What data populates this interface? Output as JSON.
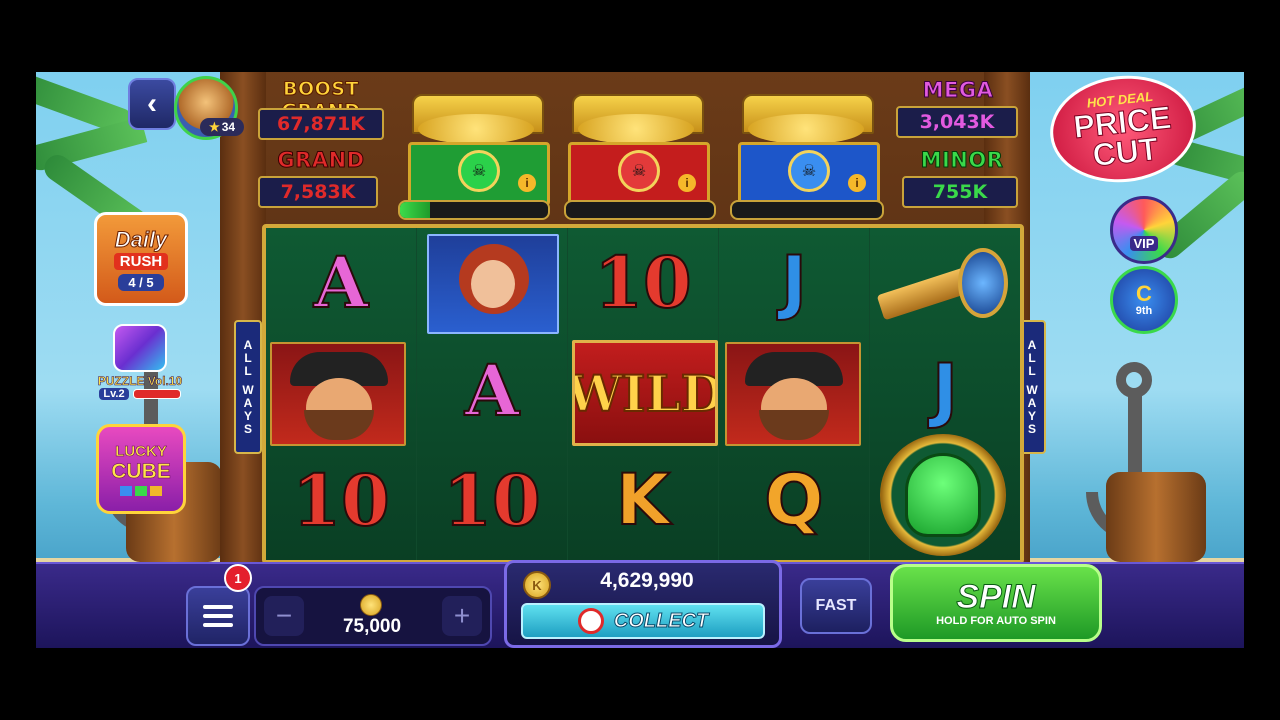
{
  "player": {
    "level": "34"
  },
  "jackpots": {
    "boost_grand": {
      "label": "BOOST GRAND",
      "value": "67,871K",
      "label_color": "#ffd43a",
      "value_color": "#e02a2a"
    },
    "grand": {
      "label": "GRAND",
      "value": "7,583K",
      "label_color": "#e02a2a",
      "value_color": "#e02a2a"
    },
    "mega": {
      "label": "MEGA",
      "value": "3,043K",
      "label_color": "#e25ae0",
      "value_color": "#e25ae0"
    },
    "minor": {
      "label": "MINOR",
      "value": "755K",
      "label_color": "#3ad94a",
      "value_color": "#3ad94a"
    }
  },
  "chests": [
    {
      "color": "green",
      "body_color": "#1f9d34",
      "gem_color": "#2bd14a",
      "meter_fill": 0.2
    },
    {
      "color": "red",
      "body_color": "#c41d1d",
      "gem_color": "#e33a3a",
      "meter_fill": 0.0
    },
    {
      "color": "blue",
      "body_color": "#1d56c9",
      "gem_color": "#3a8ef0",
      "meter_fill": 0.0
    }
  ],
  "promo": {
    "line1": "HOT DEAL",
    "line2": "PRICE",
    "line3": "CUT"
  },
  "side_left": {
    "daily_rush": {
      "title1": "Daily",
      "title2": "RUSH",
      "progress": "4 / 5"
    },
    "puzzle": {
      "label": "PUZZLE Vol.10",
      "level": "Lv.2"
    },
    "lucky_cube": {
      "line1": "LUCKY",
      "line2": "CUBE"
    }
  },
  "side_right": {
    "vip": {
      "label": "VIP"
    },
    "rank": {
      "letter": "C",
      "label": "9th"
    }
  },
  "ways_label": [
    "A",
    "L",
    "L",
    "W",
    "A",
    "Y",
    "S"
  ],
  "reels": [
    [
      "A",
      "pirate",
      "10"
    ],
    [
      "lady",
      "A",
      "10"
    ],
    [
      "10",
      "WILD",
      "K"
    ],
    [
      "J",
      "pirate",
      "Q"
    ],
    [
      "spyglass",
      "J",
      "skull-coin"
    ]
  ],
  "wild_text": "WILD",
  "bottom": {
    "notification_count": "1",
    "bet": "75,000",
    "minus": "−",
    "plus": "+",
    "balance": "4,629,990",
    "collect_label": "COLLECT",
    "fast_label": "FAST",
    "spin_label": "SPIN",
    "spin_sub": "HOLD FOR AUTO SPIN"
  }
}
